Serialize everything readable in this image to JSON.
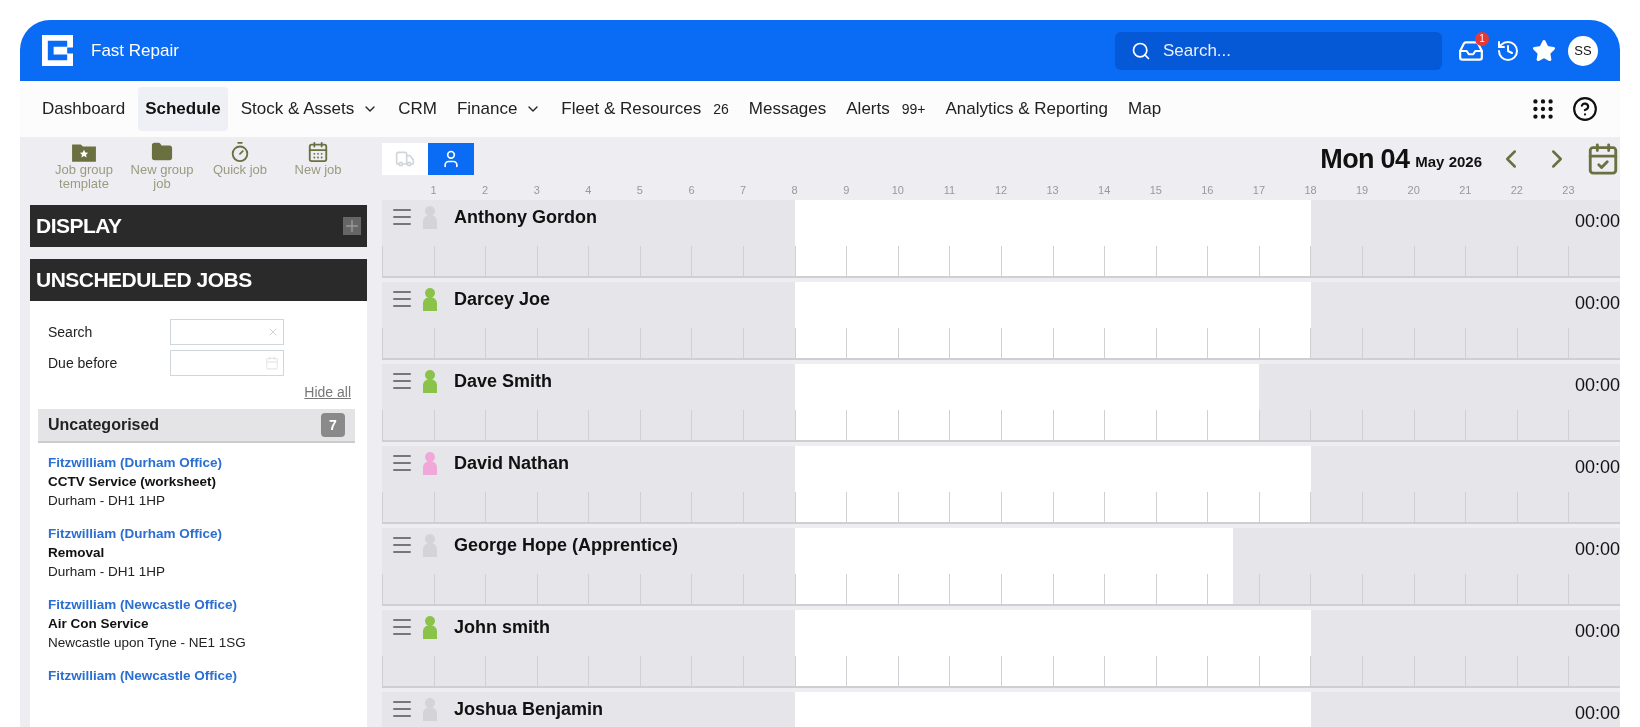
{
  "app": {
    "title": "Fast Repair",
    "search": {
      "placeholder": "Search..."
    },
    "inbox_badge": "1",
    "user_initials": "SS"
  },
  "nav": [
    {
      "label": "Dashboard",
      "selected": false,
      "has_menu": false
    },
    {
      "label": "Schedule",
      "selected": true,
      "has_menu": false
    },
    {
      "label": "Stock & Assets",
      "selected": false,
      "has_menu": true
    },
    {
      "label": "CRM",
      "selected": false,
      "has_menu": false
    },
    {
      "label": "Finance",
      "selected": false,
      "has_menu": true
    },
    {
      "label": "Fleet & Resources",
      "selected": false,
      "has_menu": false,
      "badge": "26"
    },
    {
      "label": "Messages",
      "selected": false,
      "has_menu": false
    },
    {
      "label": "Alerts",
      "selected": false,
      "has_menu": false,
      "badge": "99+"
    },
    {
      "label": "Analytics & Reporting",
      "selected": false,
      "has_menu": false
    },
    {
      "label": "Map",
      "selected": false,
      "has_menu": false
    }
  ],
  "toolbar": [
    {
      "kind": "template",
      "label": "Job group template"
    },
    {
      "kind": "group",
      "label": "New group job"
    },
    {
      "kind": "quick",
      "label": "Quick job"
    },
    {
      "kind": "new",
      "label": "New job"
    }
  ],
  "sidebar": {
    "display_title": "DISPLAY",
    "unscheduled_title": "UNSCHEDULED JOBS",
    "filters": [
      {
        "kind": "search",
        "label": "Search"
      },
      {
        "kind": "date",
        "label": "Due before"
      }
    ],
    "hide_all": "Hide all",
    "category": {
      "label": "Uncategorised",
      "count": "7"
    },
    "jobs": [
      {
        "customer": "Fitzwilliam (Durham Office)",
        "service": "CCTV Service (worksheet)",
        "location": "Durham - DH1 1HP"
      },
      {
        "customer": "Fitzwilliam (Durham Office)",
        "service": "Removal",
        "location": "Durham - DH1 1HP"
      },
      {
        "customer": "Fitzwilliam (Newcastle Office)",
        "service": "Air Con Service",
        "location": "Newcastle upon Tyne - NE1 1SG"
      },
      {
        "customer": "Fitzwilliam (Newcastle Office)"
      }
    ]
  },
  "schedule": {
    "view_toggle": [
      {
        "kind": "vehicle",
        "selected": false
      },
      {
        "kind": "staff",
        "selected": true
      }
    ],
    "date": {
      "day": "Mon 04",
      "month_year": "May 2026"
    },
    "hours": [
      "1",
      "2",
      "3",
      "4",
      "5",
      "6",
      "7",
      "8",
      "9",
      "10",
      "11",
      "12",
      "13",
      "14",
      "15",
      "16",
      "17",
      "18",
      "19",
      "20",
      "21",
      "22",
      "23"
    ],
    "staff": [
      {
        "name": "Anthony Gordon",
        "color": "#d4d4d8",
        "off_before": {
          "level": 0.3333
        },
        "off_after": {
          "level": 0.25
        },
        "total": "00:00"
      },
      {
        "name": "Darcey Joe",
        "color": "#8bc34a",
        "off_before": {
          "level": 0.3333
        },
        "off_after": {
          "level": 0.25
        },
        "total": "00:00"
      },
      {
        "name": "Dave Smith",
        "color": "#8bc34a",
        "off_before": {
          "level": 0.3333
        },
        "off_after": {
          "level": 0.2917
        },
        "total": "00:00"
      },
      {
        "name": "David Nathan",
        "color": "#f0a8d8",
        "off_before": {
          "level": 0.3333
        },
        "off_after": {
          "level": 0.25
        },
        "total": "00:00"
      },
      {
        "name": "George Hope (Apprentice)",
        "color": "#d4d4d8",
        "off_before": {
          "level": 0.3333
        },
        "off_after": {
          "level": 0.3125
        },
        "total": "00:00"
      },
      {
        "name": "John smith",
        "color": "#8bc34a",
        "off_before": {
          "level": 0.3333
        },
        "off_after": {
          "level": 0.25
        },
        "total": "00:00"
      },
      {
        "name": "Joshua Benjamin",
        "color": "#d4d4d8",
        "off_before": {
          "level": 0.3333
        },
        "off_after": {
          "level": 0.25
        },
        "total": "00:00"
      }
    ]
  }
}
